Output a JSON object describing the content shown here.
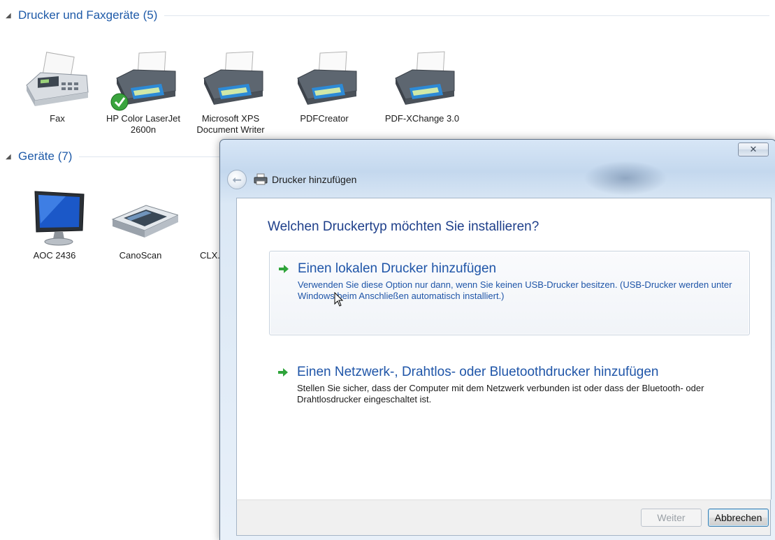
{
  "background": {
    "groups": [
      {
        "title": "Drucker und Faxgeräte (5)"
      },
      {
        "title": "Geräte (7)"
      }
    ],
    "printers": [
      {
        "label": "Fax",
        "icon": "fax-icon"
      },
      {
        "label": "HP Color LaserJet\n2600n",
        "icon": "printer-icon",
        "default_badge": "check-icon"
      },
      {
        "label": "Microsoft XPS\nDocument Writer",
        "icon": "printer-icon"
      },
      {
        "label": "PDFCreator",
        "icon": "printer-icon"
      },
      {
        "label": "PDF-XChange 3.0",
        "icon": "printer-icon"
      }
    ],
    "devices": [
      {
        "label": "AOC 2436",
        "icon": "monitor-icon"
      },
      {
        "label": "CanoScan",
        "icon": "scanner-icon"
      },
      {
        "label": "CLX.P",
        "icon": "device-icon"
      }
    ]
  },
  "dialog": {
    "close_glyph": "✕",
    "nav_title": "Drucker hinzufügen",
    "heading": "Welchen Druckertyp möchten Sie installieren?",
    "options": [
      {
        "title": "Einen lokalen Drucker hinzufügen",
        "description": "Verwenden Sie diese Option nur dann, wenn Sie keinen USB-Drucker besitzen. (USB-Drucker werden unter Windows beim Anschließen automatisch installiert.)"
      },
      {
        "title": "Einen Netzwerk-, Drahtlos- oder Bluetoothdrucker hinzufügen",
        "description": "Stellen Sie sicher, dass der Computer mit dem Netzwerk verbunden ist oder dass der Bluetooth- oder Drahtlosdrucker eingeschaltet ist."
      }
    ],
    "buttons": {
      "next": "Weiter",
      "cancel": "Abbrechen"
    }
  },
  "colors": {
    "link_blue": "#1f55a8",
    "heading_blue": "#1e3f8a",
    "arrow_green": "#2fa43a"
  }
}
